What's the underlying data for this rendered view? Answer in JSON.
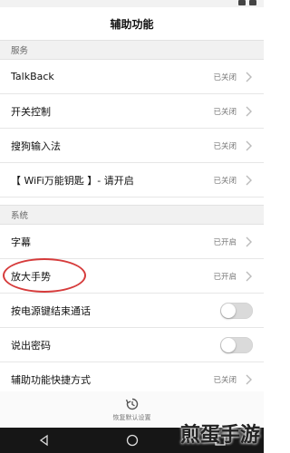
{
  "header": {
    "title": "辅助功能"
  },
  "sections": [
    {
      "label": "服务"
    },
    {
      "label": "系统"
    }
  ],
  "rows": [
    {
      "label": "TalkBack",
      "status": "已关闭"
    },
    {
      "label": "开关控制",
      "status": "已关闭"
    },
    {
      "label": "搜狗输入法",
      "status": "已关闭"
    },
    {
      "label": "【 WiFi万能钥匙 】- 请开启",
      "status": "已关闭"
    },
    {
      "label": "字幕",
      "status": "已开启"
    },
    {
      "label": "放大手势",
      "status": "已开启"
    },
    {
      "label": "按电源键结束通话",
      "toggle": false
    },
    {
      "label": "说出密码",
      "toggle": false
    },
    {
      "label": "辅助功能快捷方式",
      "status": "已关闭"
    }
  ],
  "restore": {
    "label": "恢复默认设置",
    "icon": "restore-icon"
  },
  "watermark": {
    "text": "煎蛋手游"
  },
  "nav": {
    "back": "back-icon",
    "home": "home-icon",
    "recent": "recent-apps-icon"
  }
}
